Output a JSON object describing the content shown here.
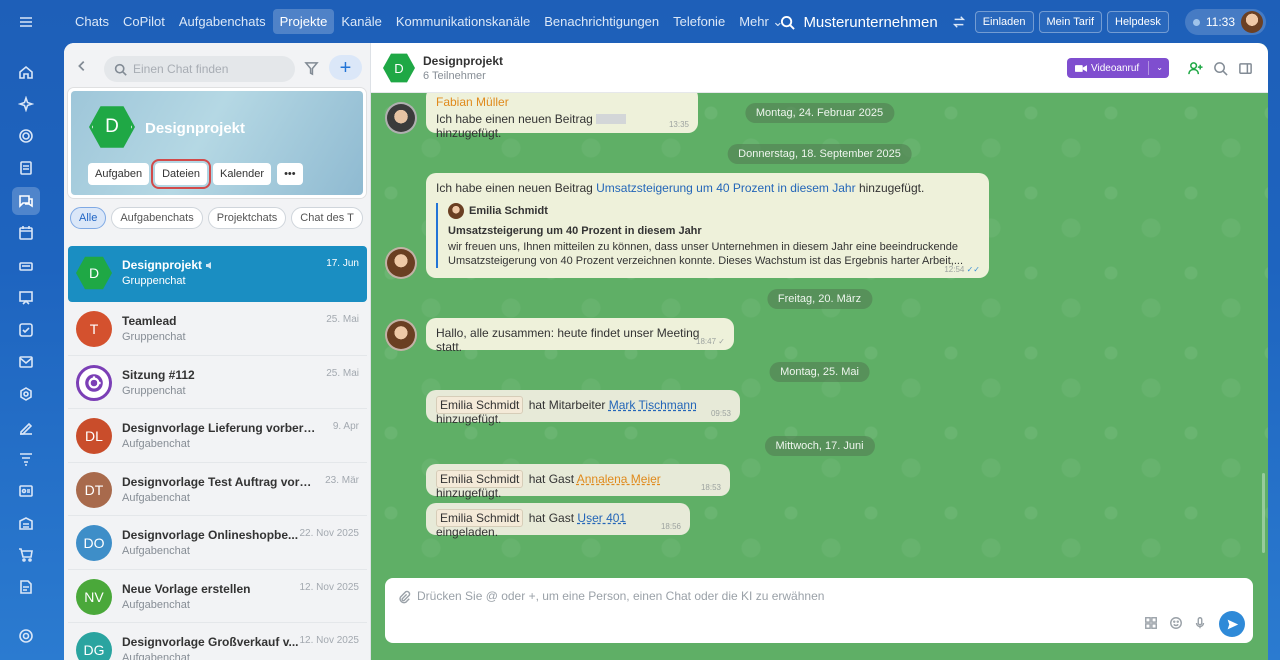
{
  "topnav": [
    "Chats",
    "CoPilot",
    "Aufgabenchats",
    "Projekte",
    "Kanäle",
    "Kommunikationskanäle",
    "Benachrichtigungen",
    "Telefonie",
    "Mehr ⌄"
  ],
  "active_tab": "Projekte",
  "company": "Musterunternehmen",
  "top_buttons": {
    "invite": "Einladen",
    "plan": "Mein Tarif",
    "help": "Helpdesk"
  },
  "clock": "11:33",
  "search": {
    "placeholder": "Einen Chat finden"
  },
  "highlight": {
    "avatar_letter": "D",
    "title": "Designprojekt",
    "buttons": [
      "Aufgaben",
      "Dateien",
      "Kalender",
      "•••"
    ],
    "selected_button": "Dateien"
  },
  "filters": [
    "Alle",
    "Aufgabenchats",
    "Projektchats",
    "Chat des T"
  ],
  "chats": [
    {
      "initials": "D",
      "name": "Designprojekt",
      "sub": "Gruppenchat",
      "date": "17. Jun",
      "color": "#1fa845",
      "active": true
    },
    {
      "initials": "T",
      "name": "Teamlead",
      "sub": "Gruppenchat",
      "date": "25. Mai",
      "color": "#d4512e"
    },
    {
      "initials": "",
      "name": "Sitzung #112",
      "sub": "Gruppenchat",
      "date": "25. Mai",
      "color": "#7b3fb6"
    },
    {
      "initials": "DL",
      "name": "Designvorlage Lieferung vorbereiten",
      "sub": "Aufgabenchat",
      "date": "9. Apr",
      "color": "#c94d2b"
    },
    {
      "initials": "DT",
      "name": "Designvorlage Test Auftrag vorbe...",
      "sub": "Aufgabenchat",
      "date": "23. Mär",
      "color": "#a86a4c"
    },
    {
      "initials": "DO",
      "name": "Designvorlage Onlineshopbe...",
      "sub": "Aufgabenchat",
      "date": "22. Nov 2025",
      "color": "#3e8ec8"
    },
    {
      "initials": "NV",
      "name": "Neue Vorlage erstellen",
      "sub": "Aufgabenchat",
      "date": "12. Nov 2025",
      "color": "#4aa83a"
    },
    {
      "initials": "DG",
      "name": "Designvorlage Großverkauf v...",
      "sub": "Aufgabenchat",
      "date": "12. Nov 2025",
      "color": "#2aa4a0"
    }
  ],
  "chat_header": {
    "avatar_letter": "D",
    "title": "Designprojekt",
    "sub": "6 Teilnehmer",
    "video": "Videoanruf"
  },
  "messages": {
    "m1": {
      "author": "Fabian Müller",
      "pre": "Ich habe einen neuen Beitrag",
      "post": "hinzugefügt.",
      "time": "13:35"
    },
    "d1": "Montag, 24. Februar 2025",
    "d2": "Donnerstag, 18. September 2025",
    "m2": {
      "pre": "Ich habe einen neuen Beitrag",
      "link": "Umsatzsteigerung um 40 Prozent in diesem Jahr",
      "post": "hinzugefügt.",
      "q_author": "Emilia Schmidt",
      "q_title": "Umsatzsteigerung um 40 Prozent in diesem Jahr",
      "q_line1": "wir freuen uns, Ihnen mitteilen zu können, dass unser Unternehmen in diesem Jahr eine beeindruckende",
      "q_line2": "Umsatzsteigerung von 40 Prozent verzeichnen konnte. Dieses Wachstum ist das Ergebnis harter Arbeit,...",
      "time": "12:54"
    },
    "d3": "Freitag, 20. März",
    "m3": {
      "text": "Hallo, alle zusammen: heute findet unser Meeting statt.",
      "time": "18:47"
    },
    "d4": "Montag, 25. Mai",
    "s1": {
      "tag": "Emilia Schmidt",
      "mid": "hat Mitarbeiter",
      "link": "Mark Tischmann",
      "post": "hinzugefügt.",
      "time": "09:53"
    },
    "d5": "Mittwoch, 17. Juni",
    "s2": {
      "tag": "Emilia Schmidt",
      "mid": "hat Gast",
      "link": "Annalena Meier",
      "post": "hinzugefügt.",
      "time": "18:53"
    },
    "s3": {
      "tag": "Emilia Schmidt",
      "mid": "hat Gast",
      "link": "User 401",
      "post": "eingeladen.",
      "time": "18:56"
    }
  },
  "composer": {
    "placeholder": "Drücken Sie @ oder +, um eine Person, einen Chat oder die KI zu erwähnen"
  }
}
